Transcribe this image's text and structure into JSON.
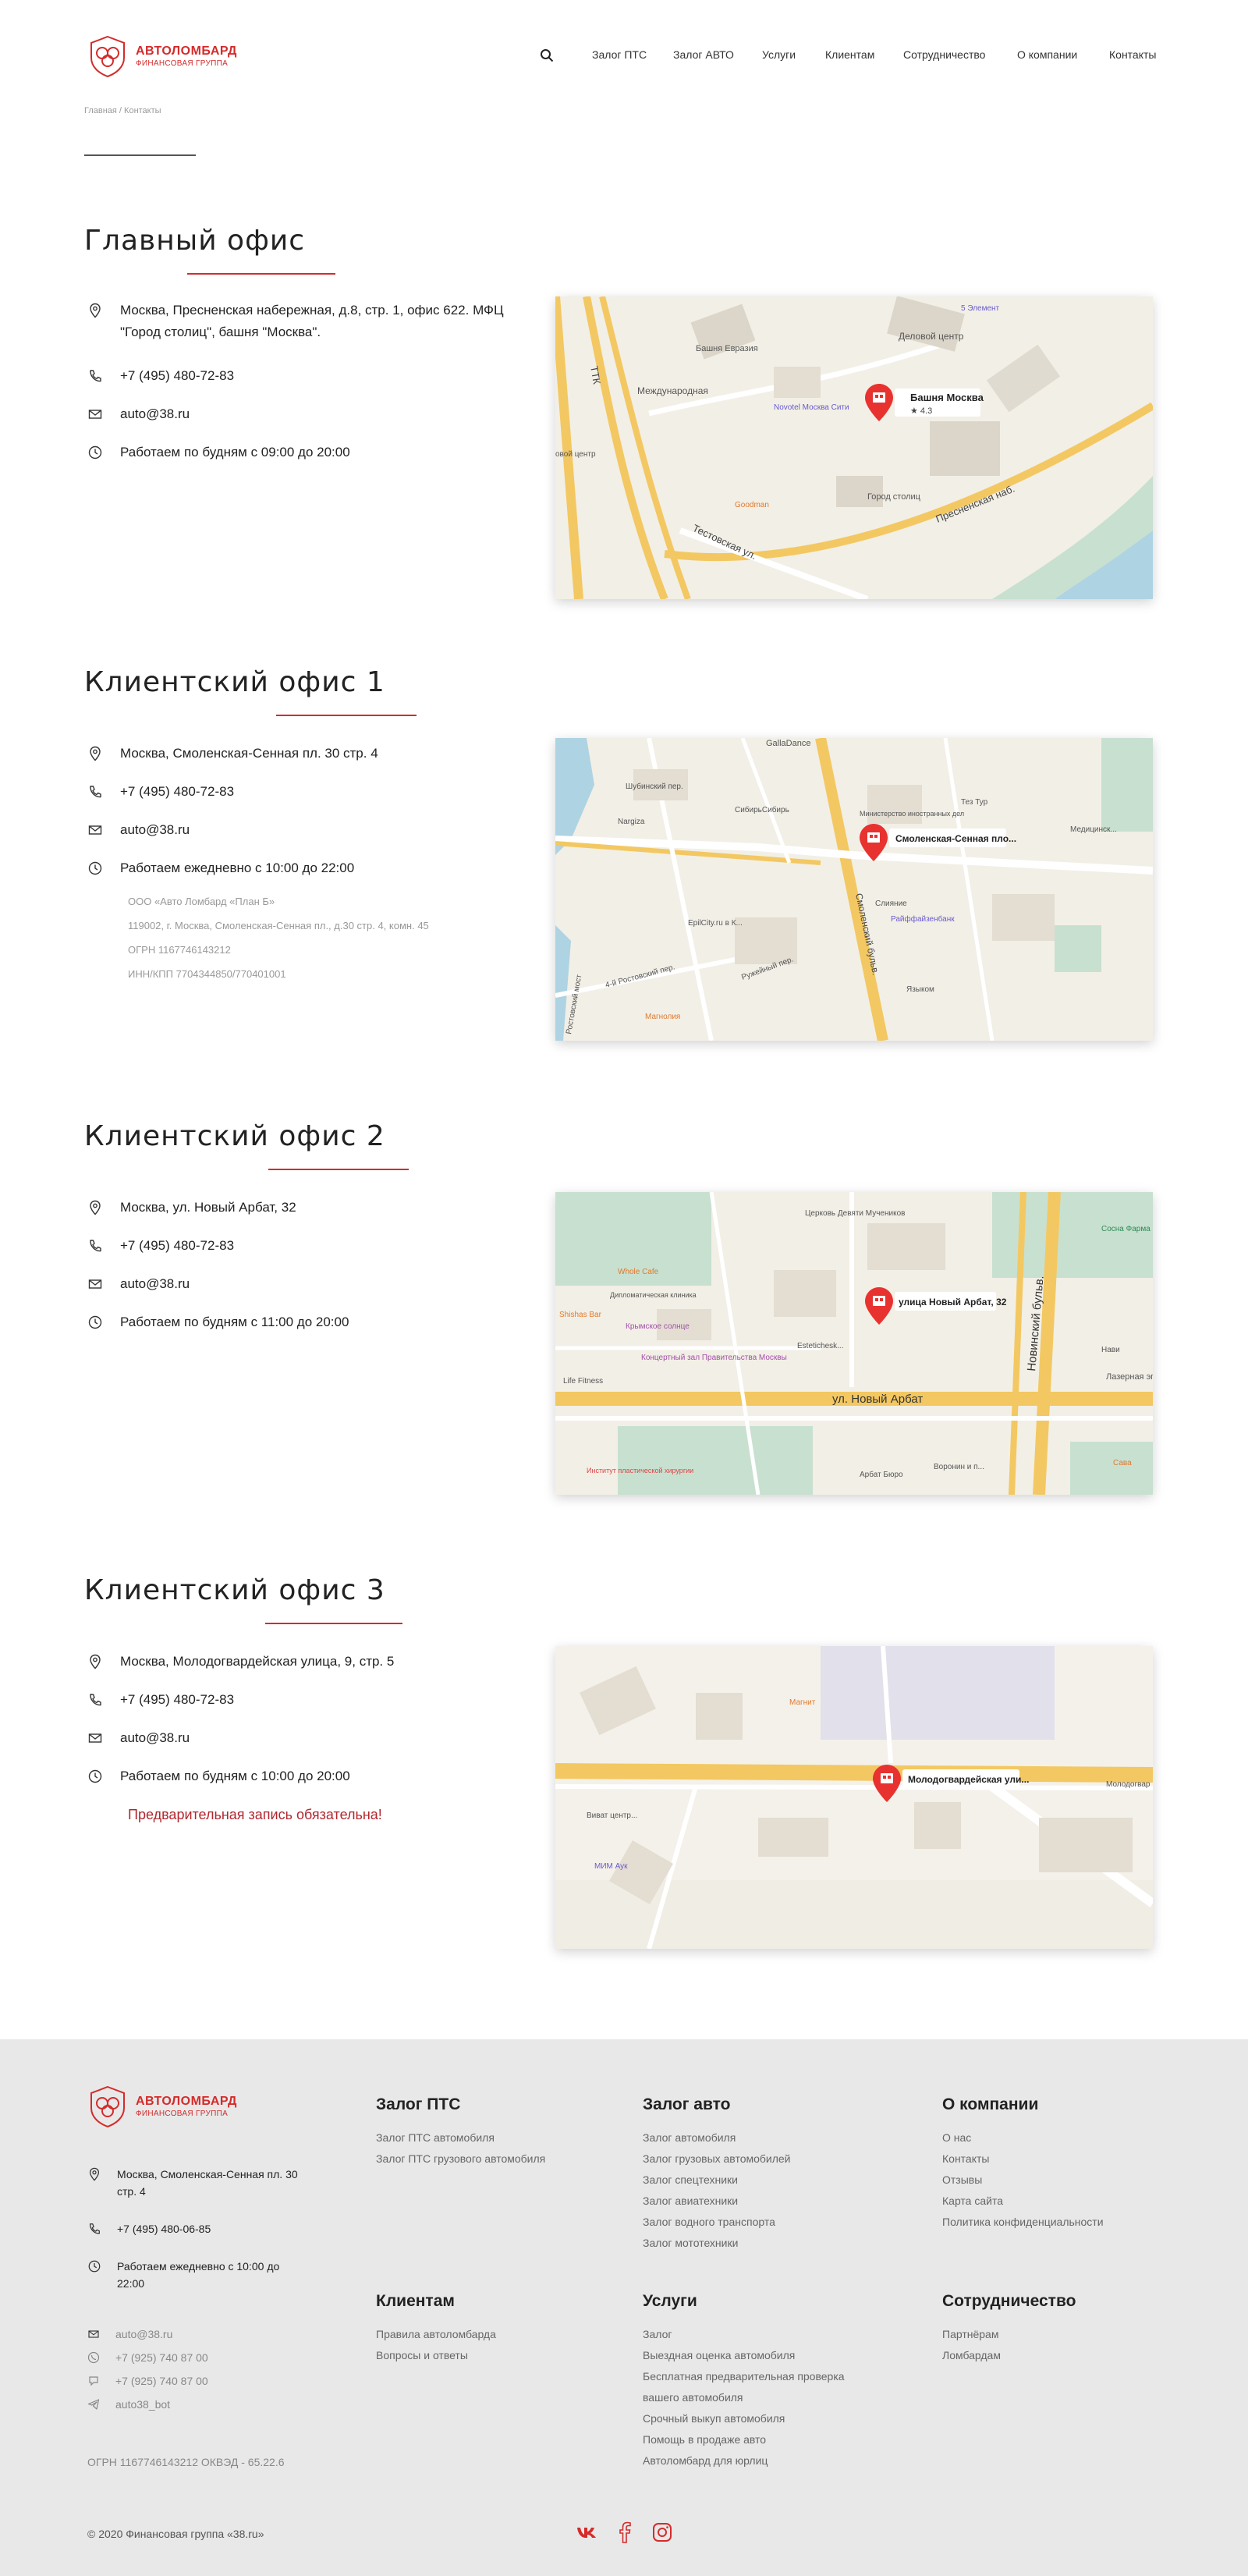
{
  "header": {
    "logo_title": "АВТОЛОМБАРД",
    "logo_sub": "ФИНАНСОВАЯ ГРУППА",
    "nav": [
      "Залог ПТС",
      "Залог АВТО",
      "Услуги",
      "Клиентам",
      "Сотрудничество",
      "О компании",
      "Контакты"
    ]
  },
  "breadcrumb": {
    "home": "Главная",
    "sep": " / ",
    "current": "Контакты"
  },
  "offices": [
    {
      "title": "Главный офис",
      "address": "Москва, Пресненская набережная, д.8, стр. 1, офис 622. МФЦ \"Город столиц\", башня \"Москва\".",
      "phone": "+7 (495) 480-72-83",
      "email": "auto@38.ru",
      "hours": "Работаем по будням с 09:00 до 20:00",
      "map": {
        "pin_label": "Башня Москва",
        "rating": "★ 4.3",
        "labels": [
          "Башня Евразия",
          "Деловой центр",
          "Международная",
          "Novotel Москва Сити",
          "Goodman",
          "Город столиц",
          "Пресненская наб.",
          "Тестовская ул.",
          "ТТК",
          "5 Элемент",
          "овой центр"
        ]
      }
    },
    {
      "title": "Клиентский офис 1",
      "address": "Москва, Смоленская-Сенная пл. 30 стр. 4",
      "phone": "+7 (495) 480-72-83",
      "email": "auto@38.ru",
      "hours": "Работаем ежедневно с 10:00 до 22:00",
      "legal": [
        "ООО «Авто Ломбард «План Б»",
        "119002, г. Москва, Смоленская-Сенная пл., д.30 стр. 4, комн. 45",
        "ОГРН 1167746143212",
        "ИНН/КПП 7704344850/770401001"
      ],
      "map": {
        "pin_label": "Смоленская-Сенная пло...",
        "labels": [
          "GallaDance",
          "Шубинский пер.",
          "СибирьСибирь",
          "Nargiza",
          "Министерство иностранных дел",
          "Тез Тур",
          "Медицинск...",
          "Слияние",
          "Райффайзенбанк",
          "EpilCity.ru в К...",
          "Ружейный пер.",
          "Смоленский бульв.",
          "Языком",
          "Магнолия",
          "4-й Ростовский пер.",
          "Ростовский мост"
        ]
      }
    },
    {
      "title": "Клиентский офис 2",
      "address": "Москва, ул. Новый Арбат, 32",
      "phone": "+7 (495) 480-72-83",
      "email": "auto@38.ru",
      "hours": "Работаем по будням с 11:00 до 20:00",
      "map": {
        "pin_label": "улица Новый Арбат, 32",
        "labels": [
          "Церковь Девяти Мучеников",
          "Whole Cafe",
          "Дипломатическая клиника",
          "Shishas Bar",
          "Крымское солнце",
          "Концертный зал Правительства Москвы",
          "Life Fitness",
          "Estetichesk...",
          "ул. Новый Арбат",
          "Новинский бульв.",
          "Сосна Фарма",
          "Лазерная эп",
          "Нави",
          "Арбат Бюро",
          "Воронин и п...",
          "Институт пластической хирургии",
          "Сава"
        ]
      }
    },
    {
      "title": "Клиентский офис 3",
      "address": "Москва, Молодогвардейская улица, 9, стр. 5",
      "phone": "+7 (495) 480-72-83",
      "email": "auto@38.ru",
      "hours": "Работаем по будням с 10:00 до 20:00",
      "note": "Предварительная запись обязательна!",
      "map": {
        "pin_label": "Молодогвардейская ули...",
        "labels": [
          "Магнит",
          "Виват центр...",
          "МИМ Аук",
          "Молодогвар"
        ]
      }
    }
  ],
  "footer": {
    "address": "Москва, Смоленская-Сенная пл. 30 стр. 4",
    "phone": "+7 (495) 480-06-85",
    "hours": "Работаем ежедневно с 10:00 до 22:00",
    "email": "auto@38.ru",
    "whatsapp": "+7 (925) 740 87 00",
    "viber": "+7 (925) 740 87 00",
    "telegram": "auto38_bot",
    "ogrn": "ОГРН 1167746143212 ОКВЭД - 65.22.6",
    "copyright": "© 2020 Финансовая группа «38.ru»",
    "columns": [
      {
        "title": "Залог ПТС",
        "links": [
          "Залог ПТС автомобиля",
          "Залог ПТС грузового автомобиля"
        ]
      },
      {
        "title": "Залог авто",
        "links": [
          "Залог автомобиля",
          "Залог грузовых автомобилей",
          "Залог спецтехники",
          "Залог авиатехники",
          "Залог водного транспорта",
          "Залог мототехники"
        ]
      },
      {
        "title": "О компании",
        "links": [
          "О нас",
          "Контакты",
          "Отзывы",
          "Карта сайта",
          "Политика конфиденциальности"
        ]
      },
      {
        "title": "Клиентам",
        "links": [
          "Правила автоломбарда",
          "Вопросы и ответы"
        ]
      },
      {
        "title": "Услуги",
        "links": [
          "Залог",
          "Выездная оценка автомобиля",
          "Бесплатная предварительная проверка",
          "вашего автомобиля",
          "Срочный выкуп автомобиля",
          "Помощь в продаже авто",
          "Автоломбард для юрлиц"
        ]
      },
      {
        "title": "Сотрудничество",
        "links": [
          "Партнёрам",
          "Ломбардам"
        ]
      }
    ]
  },
  "colors": {
    "accent": "#d52b2b",
    "note": "#b3262e",
    "footer_bg": "#e8e8e8"
  }
}
